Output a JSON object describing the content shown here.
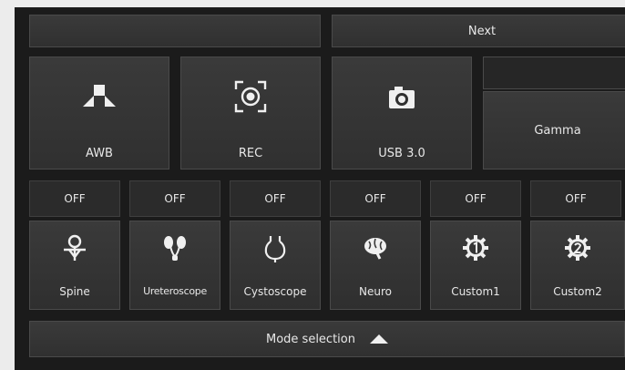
{
  "top_bar": {
    "next_label": "Next"
  },
  "controls": {
    "awb_label": "AWB",
    "rec_label": "REC",
    "usb_label": "USB 3.0",
    "gamma_label": "Gamma"
  },
  "modes": [
    {
      "state": "OFF",
      "label": "Spine",
      "icon": "spine-icon"
    },
    {
      "state": "OFF",
      "label": "Ureteroscope",
      "icon": "kidney-icon"
    },
    {
      "state": "OFF",
      "label": "Cystoscope",
      "icon": "bladder-icon"
    },
    {
      "state": "OFF",
      "label": "Neuro",
      "icon": "brain-icon"
    },
    {
      "state": "OFF",
      "label": "Custom1",
      "icon": "gear-1-icon"
    },
    {
      "state": "OFF",
      "label": "Custom2",
      "icon": "gear-2-icon"
    }
  ],
  "footer": {
    "mode_selection_label": "Mode selection",
    "arrow_icon": "triangle-up-icon"
  },
  "colors": {
    "background": "#1b1b1b",
    "button": "#363636",
    "text": "#e8e8e8"
  }
}
